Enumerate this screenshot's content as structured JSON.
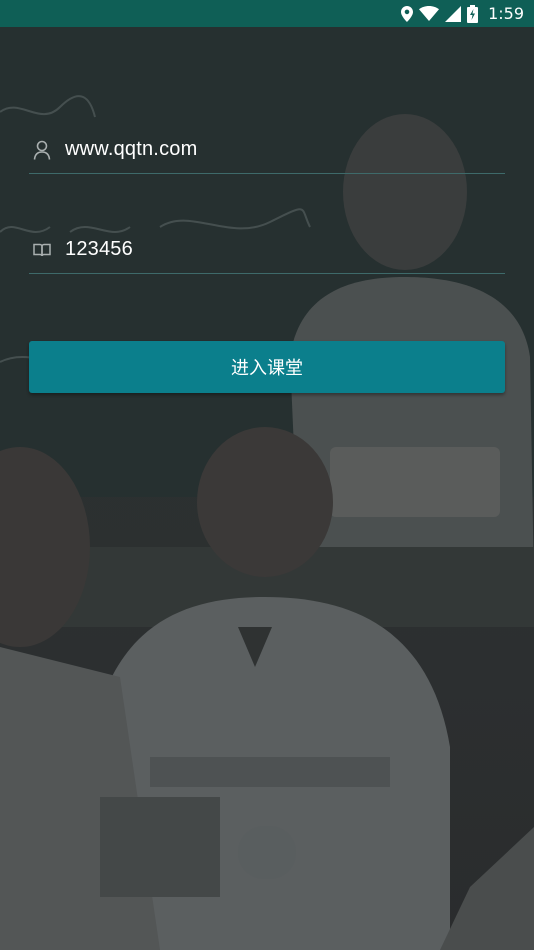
{
  "status_bar": {
    "time": "1:59",
    "icons": [
      "location-icon",
      "wifi-icon",
      "signal-icon",
      "battery-charging-icon"
    ]
  },
  "background": {
    "blackboard_text": [
      "today",
      "the weekend ?",
      "yesterday"
    ]
  },
  "login_form": {
    "username": {
      "icon": "person-icon",
      "value": "www.qqtn.com"
    },
    "password": {
      "icon": "book-icon",
      "value": "123456"
    },
    "enter_button_label": "进入课堂"
  },
  "colors": {
    "status_bar": "#0f5f56",
    "button": "#0b7f8c",
    "underline": "#3e6a6a"
  }
}
